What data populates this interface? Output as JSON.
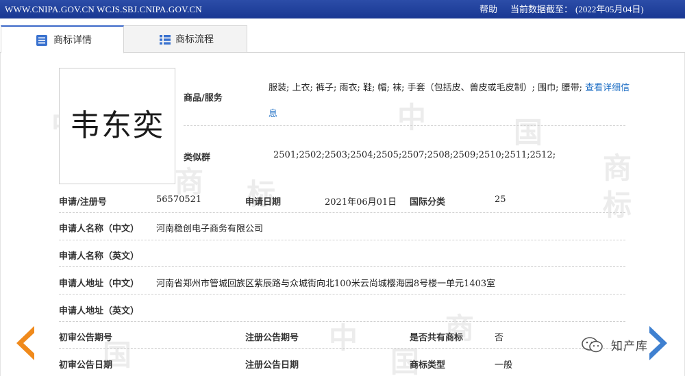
{
  "topbar": {
    "sites": "WWW.CNIPA.GOV.CN  WCJS.SBJ.CNIPA.GOV.CN",
    "help": "帮助",
    "as_of_label": "当前数据截至：",
    "as_of_date": "(2022年05月04日)"
  },
  "tabs": [
    {
      "label": "商标详情",
      "icon": "list-icon",
      "active": true
    },
    {
      "label": "商标流程",
      "icon": "flow-list-icon",
      "active": false
    }
  ],
  "trademark": {
    "image_text": "韦东奕"
  },
  "goods": {
    "label": "商品/服务",
    "text": "服装; 上衣; 裤子; 雨衣; 鞋; 帽; 袜; 手套（包括皮、兽皮或毛皮制）; 围巾; 腰带;",
    "link": "查看详细信息"
  },
  "similar_group": {
    "label": "类似群",
    "value": "2501;2502;2503;2504;2505;2507;2508;2509;2510;2511;2512;"
  },
  "rows": {
    "reg_no": {
      "label": "申请/注册号",
      "value": "56570521"
    },
    "app_date": {
      "label": "申请日期",
      "value": "2021年06月01日"
    },
    "intl_class": {
      "label": "国际分类",
      "value": "25"
    },
    "applicant_cn": {
      "label": "申请人名称（中文）",
      "value": "河南稳创电子商务有限公司"
    },
    "applicant_en": {
      "label": "申请人名称（英文）",
      "value": ""
    },
    "address_cn": {
      "label": "申请人地址（中文）",
      "value": "河南省郑州市管城回族区紫辰路与众城街向北100米云尚城樱海园8号楼一单元1403室"
    },
    "address_en": {
      "label": "申请人地址（英文）",
      "value": ""
    },
    "prelim_pub_no": {
      "label": "初审公告期号",
      "value": ""
    },
    "reg_pub_no": {
      "label": "注册公告期号",
      "value": ""
    },
    "shared": {
      "label": "是否共有商标",
      "value": "否"
    },
    "prelim_pub_date": {
      "label": "初审公告日期",
      "value": ""
    },
    "reg_pub_date": {
      "label": "注册公告日期",
      "value": ""
    },
    "tm_type": {
      "label": "商标类型",
      "value": "一般"
    }
  },
  "watermark": {
    "chars": [
      "中",
      "国",
      "商",
      "标"
    ]
  },
  "badge": {
    "text": "知产库",
    "icon": "wechat-icon"
  },
  "colors": {
    "topbar": "#1f3f9e",
    "arrow_left": "#f08a1c",
    "arrow_right": "#3f80d0",
    "link": "#1f6fc5"
  }
}
